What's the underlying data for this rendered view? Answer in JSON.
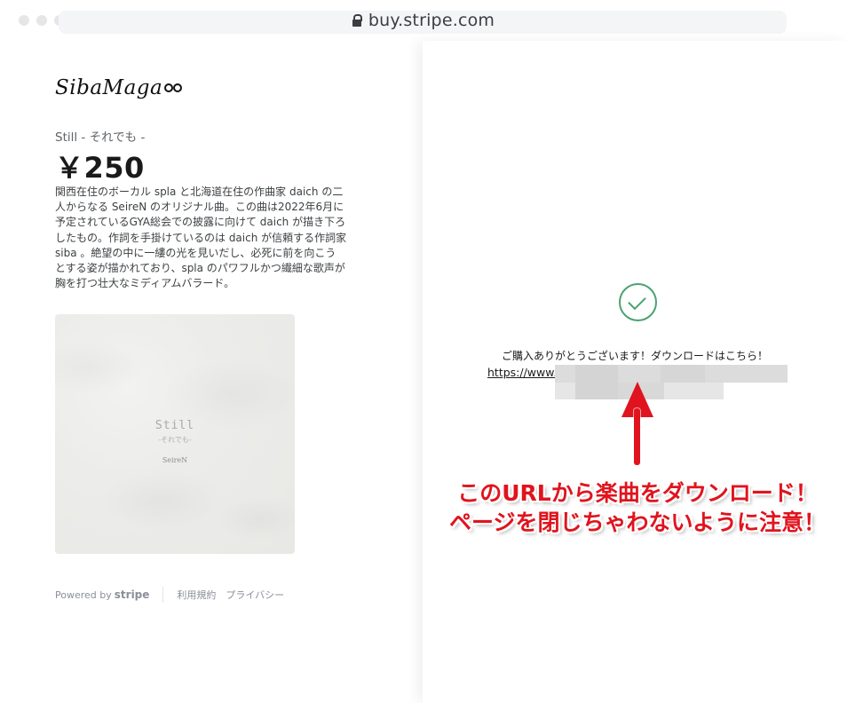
{
  "browser": {
    "url": "buy.stripe.com"
  },
  "product": {
    "brand_logo_text": "SibaMaga",
    "name": "Still - それでも -",
    "price": "￥250",
    "description_lines": [
      "関西在住のボーカル spla と北海道在住の作曲家 daich の二",
      "人からなる SeireN のオリジナル曲。この曲は2022年6月に",
      "予定されているGYA総会での披露に向けて daich が描き下ろ",
      "したもの。作詞を手掛けているのは daich が信頼する作詞家",
      "siba 。絶望の中に一縷の光を見いだし、必死に前を向こう",
      "とする姿が描かれており、spla のパワフルかつ繊細な歌声が",
      "胸を打つ壮大なミディアムバラード。"
    ],
    "cover": {
      "title": "Still",
      "subtitle": "-それでも-",
      "artist": "SeireN"
    }
  },
  "footer": {
    "powered_by": "Powered by",
    "stripe": "stripe",
    "terms": "利用規約",
    "privacy": "プライバシー"
  },
  "confirmation": {
    "thanks_text": "ご購入ありがとうございます！ダウンロードはこちら！",
    "link_text": "https://www."
  },
  "annotation": {
    "line1": "このURLから楽曲をダウンロード！",
    "line2": "ページを閉じちゃわないように注意！",
    "color": "#e0141e"
  },
  "colors": {
    "success": "#4aa36f",
    "muted_text": "#8a8f98"
  }
}
